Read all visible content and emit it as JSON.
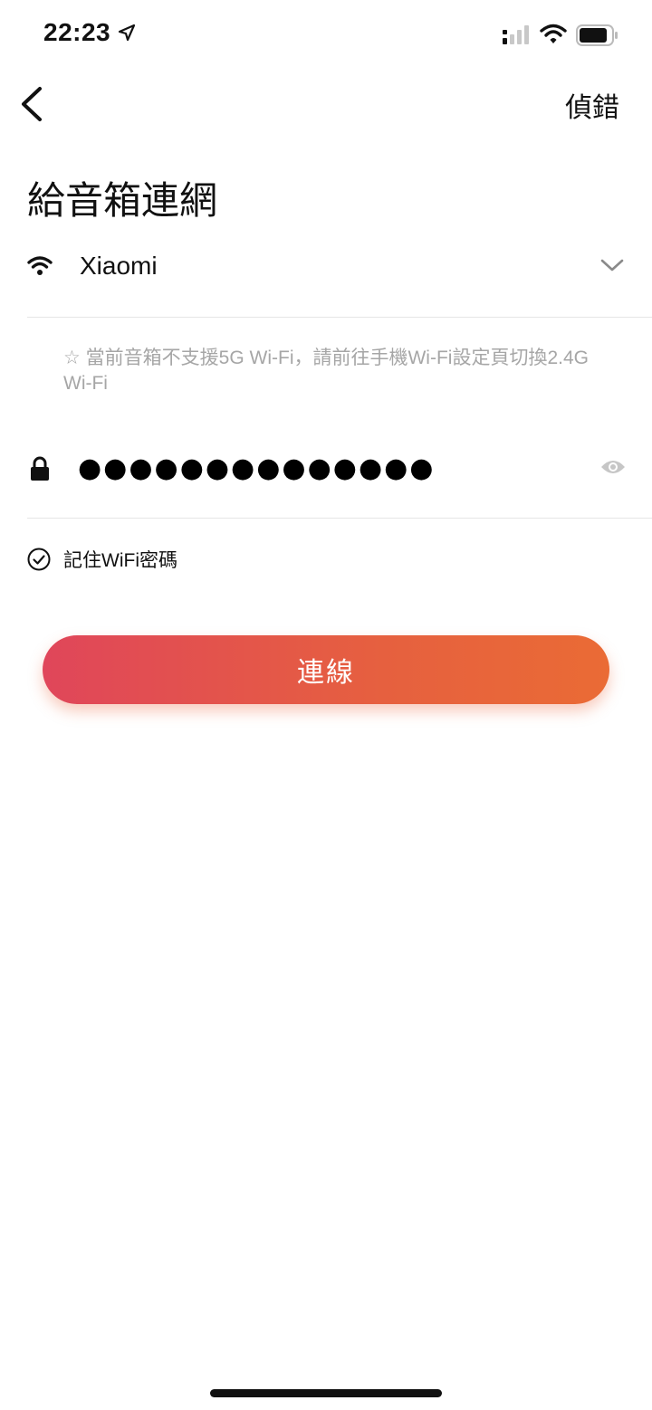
{
  "status_bar": {
    "time": "22:23"
  },
  "nav": {
    "debug_label": "偵錯"
  },
  "title": "給音箱連網",
  "wifi": {
    "ssid": "Xiaomi"
  },
  "hint": "☆ 當前音箱不支援5G Wi-Fi，請前往手機Wi-Fi設定頁切換2.4G Wi-Fi",
  "password": {
    "masked_value": "●●●●●●●●●●●●●●"
  },
  "remember": {
    "label": "記住WiFi密碼",
    "checked": true
  },
  "connect_button": {
    "label": "連線"
  },
  "colors": {
    "accent_start": "#e0465a",
    "accent_end": "#ea6b35",
    "hint_text": "#a6a6a6",
    "divider": "#e6e6e6"
  }
}
